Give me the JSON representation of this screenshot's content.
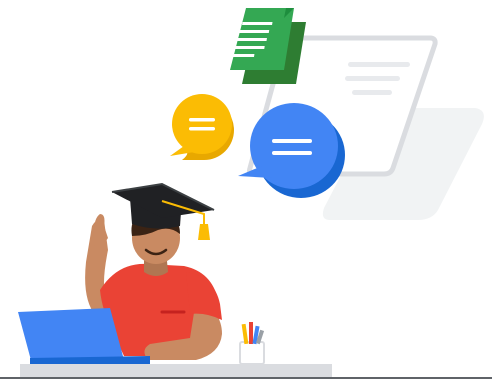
{
  "illustration": {
    "subject": "graduate-at-laptop",
    "icons": [
      "document-icon",
      "chat-bubble-icon",
      "chat-bubble-icon",
      "graduation-cap-icon",
      "laptop-icon",
      "pencil-cup-icon",
      "browser-window-icon"
    ],
    "colors": {
      "google_blue": "#4285F4",
      "google_yellow": "#FBBC04",
      "google_green": "#34A853",
      "shirt_red": "#EA4335",
      "skin": "#C98A62",
      "hair": "#3B2314",
      "cap": "#202124",
      "desk": "#DADCE0",
      "panel_gray": "#F1F3F4",
      "frame_gray": "#DADCE0"
    }
  }
}
